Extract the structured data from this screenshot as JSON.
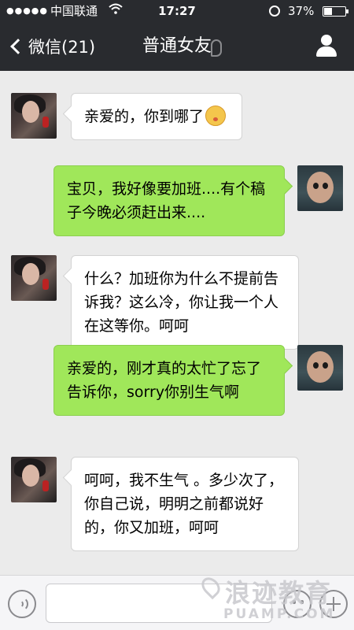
{
  "status_bar": {
    "signal": "●●●●●",
    "carrier": "中国联通",
    "wifi_icon": "wifi-icon",
    "time": "17:27",
    "battery": "37%",
    "battery_level": 0.37
  },
  "nav": {
    "back_label": "微信(21)",
    "title": "普通女友"
  },
  "messages": [
    {
      "side": "left",
      "text": "亲爱的，你到哪了",
      "emoji": "kiss-face"
    },
    {
      "side": "right",
      "text": "宝贝，我好像要加班....有个稿子今晚必须赶出来...."
    },
    {
      "side": "left",
      "text": "什么？加班你为什么不提前告诉我？这么冷，你让我一个人在这等你。呵呵"
    },
    {
      "side": "right",
      "text": "亲爱的，刚才真的太忙了忘了告诉你，sorry你别生气啊"
    },
    {
      "side": "left",
      "text": "呵呵，我不生气 。多少次了，你自己说，明明之前都说好的，你又加班，呵呵"
    }
  ],
  "watermark": {
    "main": "浪迹教育",
    "sub": "PUAMP.COM"
  },
  "colors": {
    "nav_bg": "#292b2f",
    "chat_bg": "#ebebeb",
    "bubble_sent": "#a0e75a",
    "bubble_received": "#ffffff"
  }
}
